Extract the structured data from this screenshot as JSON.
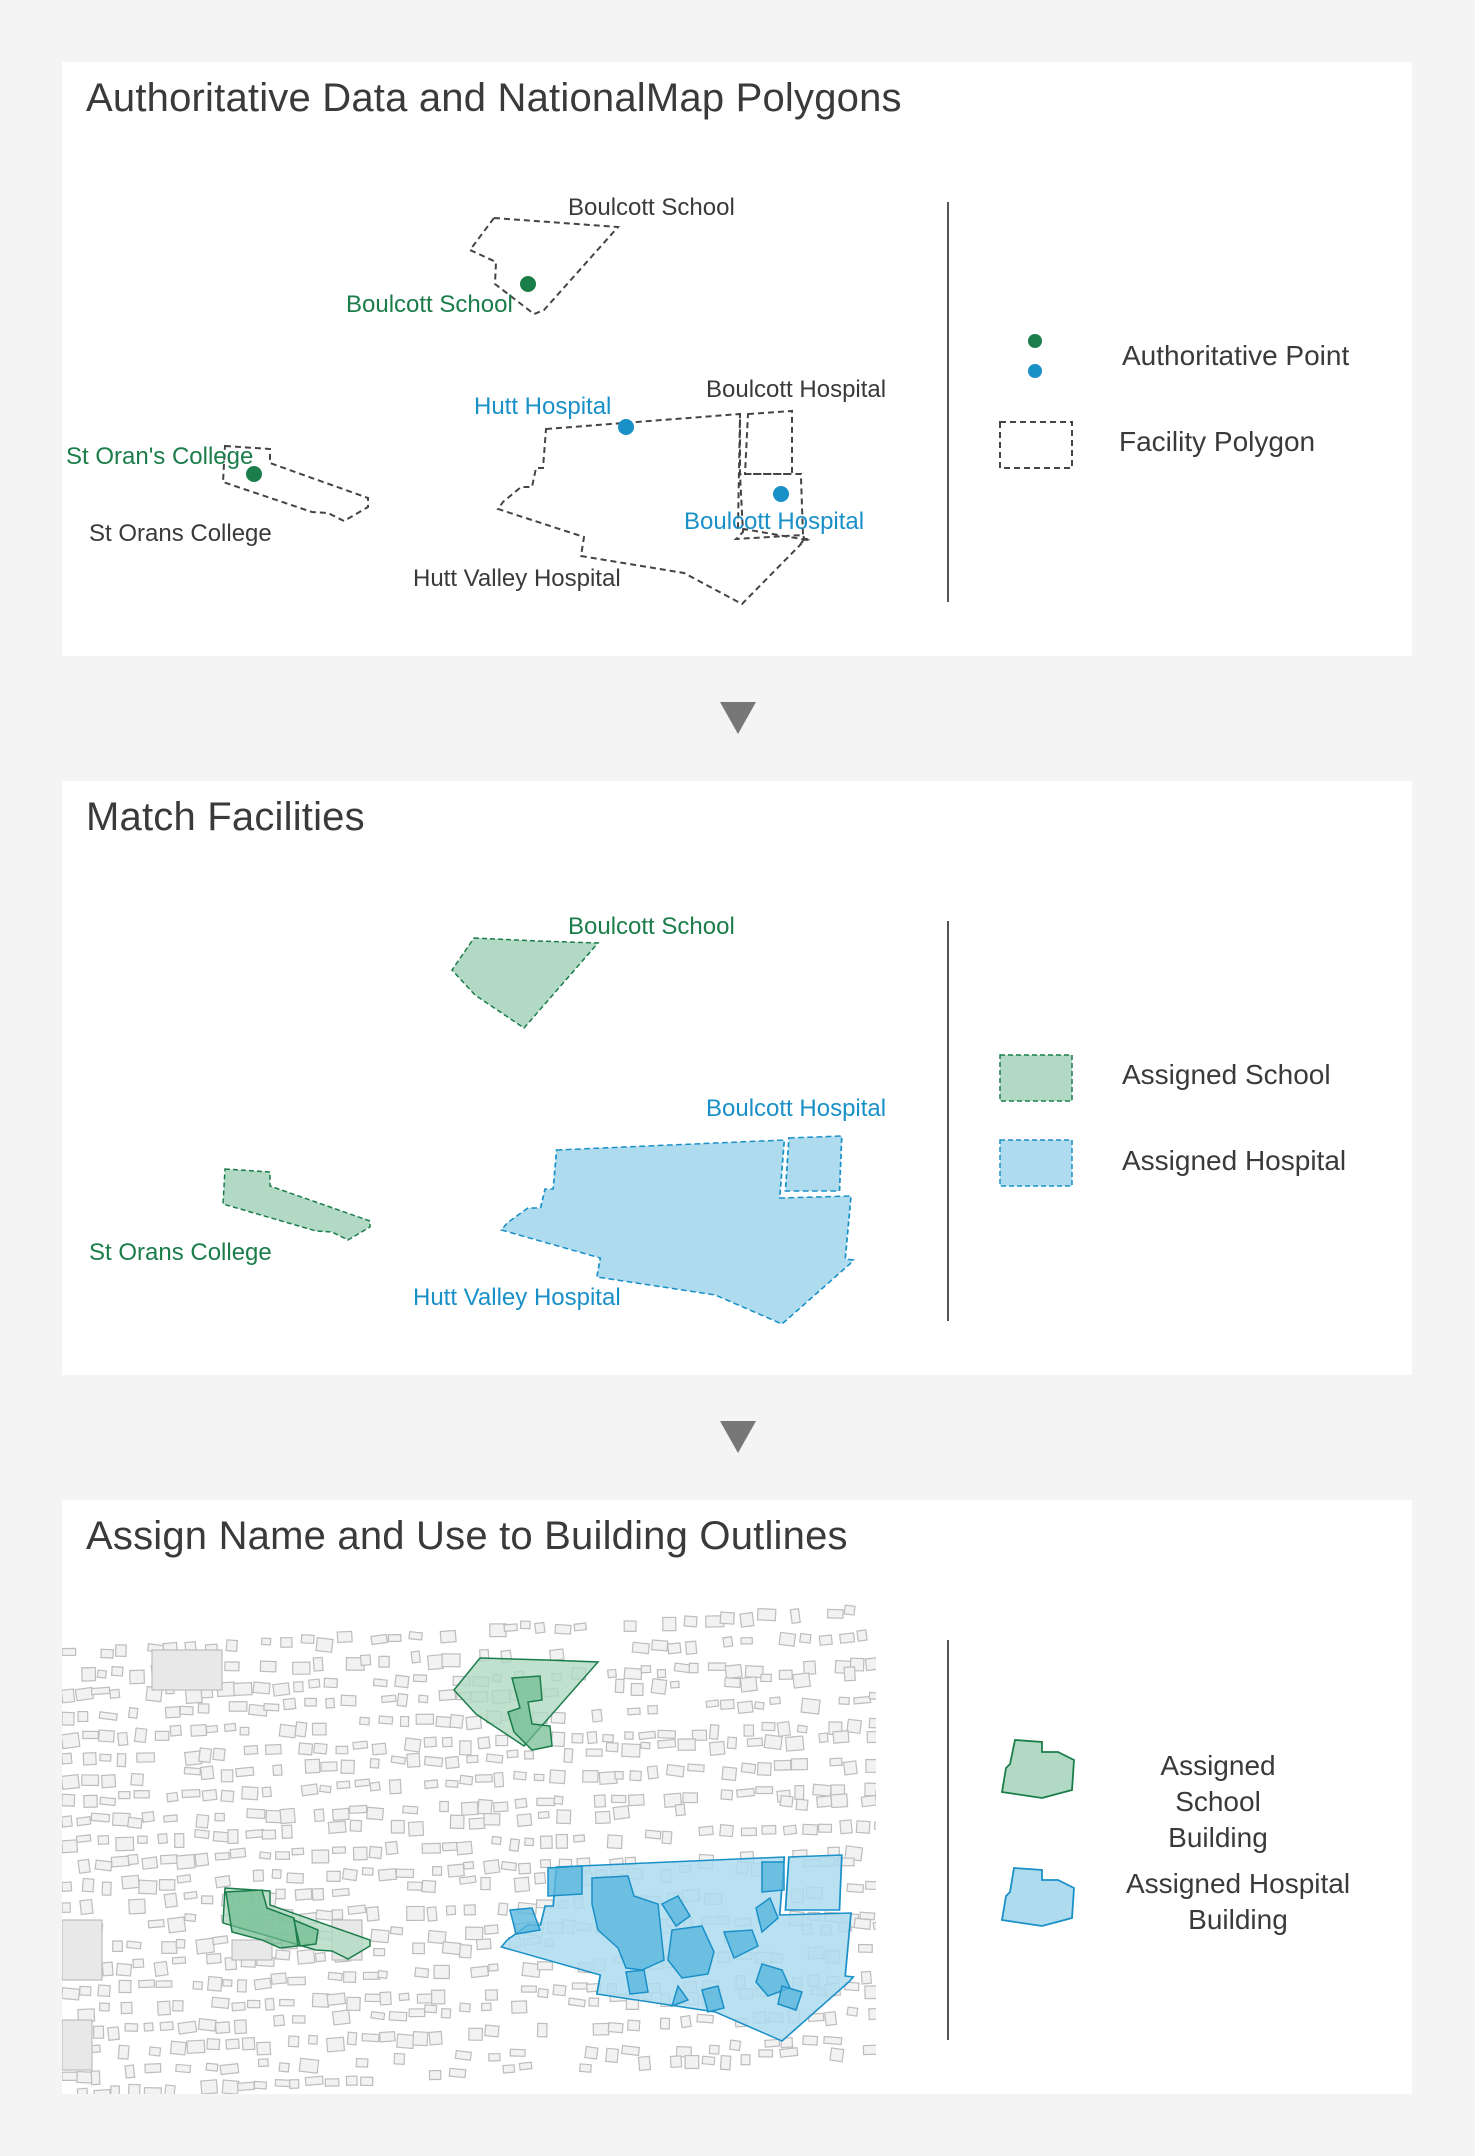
{
  "colors": {
    "school": "#1b7d4a",
    "school_fill": "#b2d9c3",
    "hospital": "#1a90c8",
    "hospital_fill": "#aedcee",
    "outline": "#444444",
    "building": "#bdbdbd"
  },
  "panel1": {
    "title": "Authoritative Data and NationalMap Polygons",
    "labels": {
      "boulcott_school_poly": "Boulcott School",
      "boulcott_school_point": "Boulcott School",
      "boulcott_hospital_poly": "Boulcott Hospital",
      "hutt_hospital_point": "Hutt Hospital",
      "st_orans_point": "St Oran's College",
      "st_orans_poly": "St Orans College",
      "boulcott_hospital_point": "Boulcott Hospital",
      "hutt_valley_poly": "Hutt Valley Hospital"
    },
    "legend": {
      "point": "Authoritative Point",
      "polygon": "Facility Polygon"
    }
  },
  "panel2": {
    "title": "Match Facilities",
    "labels": {
      "boulcott_school": "Boulcott School",
      "boulcott_hospital": "Boulcott Hospital",
      "st_orans": "St Orans College",
      "hutt_valley": "Hutt Valley Hospital"
    },
    "legend": {
      "school": "Assigned School",
      "hospital": "Assigned Hospital"
    }
  },
  "panel3": {
    "title": "Assign Name and Use to Building Outlines",
    "legend": {
      "school_line1": "Assigned School",
      "school_line2": "Building",
      "hospital_line1": "Assigned Hospital",
      "hospital_line2": "Building"
    }
  },
  "arrows": [
    "down-triangle-icon",
    "down-triangle-icon"
  ]
}
